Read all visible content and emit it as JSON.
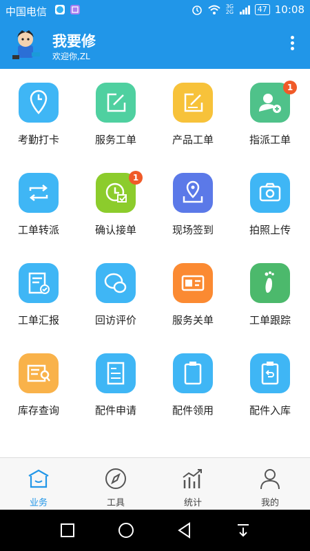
{
  "status": {
    "carrier": "中国电信",
    "network": "3G 2G",
    "battery": "47",
    "time": "10:08"
  },
  "header": {
    "title": "我要修",
    "subtitle": "欢迎你,ZL"
  },
  "grid": [
    {
      "label": "考勤打卡",
      "icon": "clock-pin-icon",
      "color": "#3fb6f5"
    },
    {
      "label": "服务工单",
      "icon": "edit-icon",
      "color": "#4fd0a0"
    },
    {
      "label": "产品工单",
      "icon": "edit-icon",
      "color": "#f7c23a"
    },
    {
      "label": "指派工单",
      "icon": "add-user-icon",
      "color": "#4fc28a",
      "badge": "1"
    },
    {
      "label": "工单转派",
      "icon": "transfer-icon",
      "color": "#3fb6f5"
    },
    {
      "label": "确认接单",
      "icon": "clock-check-icon",
      "color": "#8ccc2c",
      "badge": "1"
    },
    {
      "label": "现场签到",
      "icon": "location-icon",
      "color": "#5b79e8"
    },
    {
      "label": "拍照上传",
      "icon": "camera-icon",
      "color": "#3fb6f5"
    },
    {
      "label": "工单汇报",
      "icon": "report-icon",
      "color": "#3fb6f5"
    },
    {
      "label": "回访评价",
      "icon": "chat-icon",
      "color": "#3fb6f5"
    },
    {
      "label": "服务关单",
      "icon": "id-card-icon",
      "color": "#fb8a32"
    },
    {
      "label": "工单跟踪",
      "icon": "footprint-icon",
      "color": "#4cb96c"
    },
    {
      "label": "库存查询",
      "icon": "inventory-search-icon",
      "color": "#f9b24a"
    },
    {
      "label": "配件申请",
      "icon": "document-icon",
      "color": "#3fb6f5"
    },
    {
      "label": "配件领用",
      "icon": "clipboard-icon",
      "color": "#3fb6f5"
    },
    {
      "label": "配件入库",
      "icon": "clipboard-return-icon",
      "color": "#3fb6f5"
    }
  ],
  "tabs": [
    {
      "label": "业务",
      "icon": "home-icon",
      "active": true
    },
    {
      "label": "工具",
      "icon": "compass-icon",
      "active": false
    },
    {
      "label": "统计",
      "icon": "chart-icon",
      "active": false
    },
    {
      "label": "我的",
      "icon": "person-icon",
      "active": false
    }
  ],
  "colors": {
    "primary": "#2196e8",
    "badge": "#f05a28"
  }
}
